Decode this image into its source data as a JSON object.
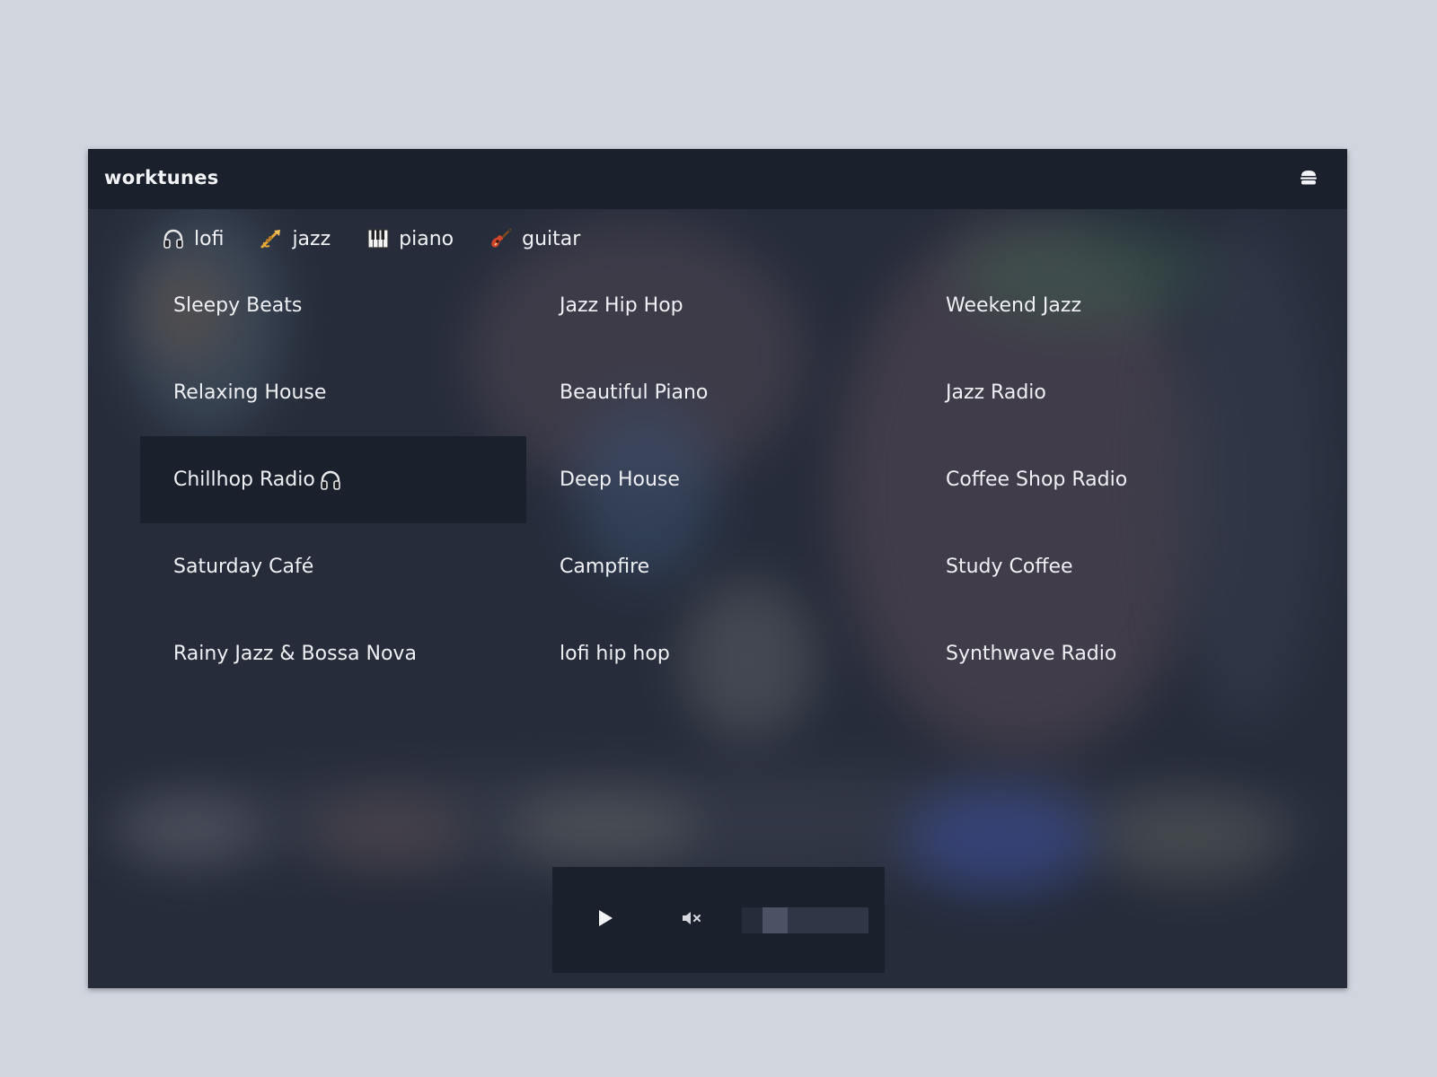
{
  "app": {
    "title": "worktunes"
  },
  "header": {
    "menu_icon": "hamburger-icon"
  },
  "genres": [
    {
      "label": "lofi",
      "icon": "headphones-icon"
    },
    {
      "label": "jazz",
      "icon": "trumpet-icon"
    },
    {
      "label": "piano",
      "icon": "piano-keys-icon"
    },
    {
      "label": "guitar",
      "icon": "guitar-icon"
    }
  ],
  "stations": {
    "col1": [
      "Sleepy Beats",
      "Relaxing House",
      "Chillhop Radio",
      "Saturday Café",
      "Rainy Jazz & Bossa Nova"
    ],
    "col2": [
      "Jazz Hip Hop",
      "Beautiful Piano",
      "Deep House",
      "Campfire",
      "lofi hip hop"
    ],
    "col3": [
      "Weekend Jazz",
      "Jazz Radio",
      "Coffee Shop Radio",
      "Study Coffee",
      "Synthwave Radio"
    ],
    "active": "Chillhop Radio"
  },
  "player": {
    "state": "paused",
    "play_icon": "play-icon",
    "mute_icon": "volume-muted-icon",
    "volume_percent": 20
  },
  "colors": {
    "page_bg": "#d1d5de",
    "panel_dark": "#1b202d",
    "content_bg": "#262c3a",
    "text": "#eef0f4"
  }
}
